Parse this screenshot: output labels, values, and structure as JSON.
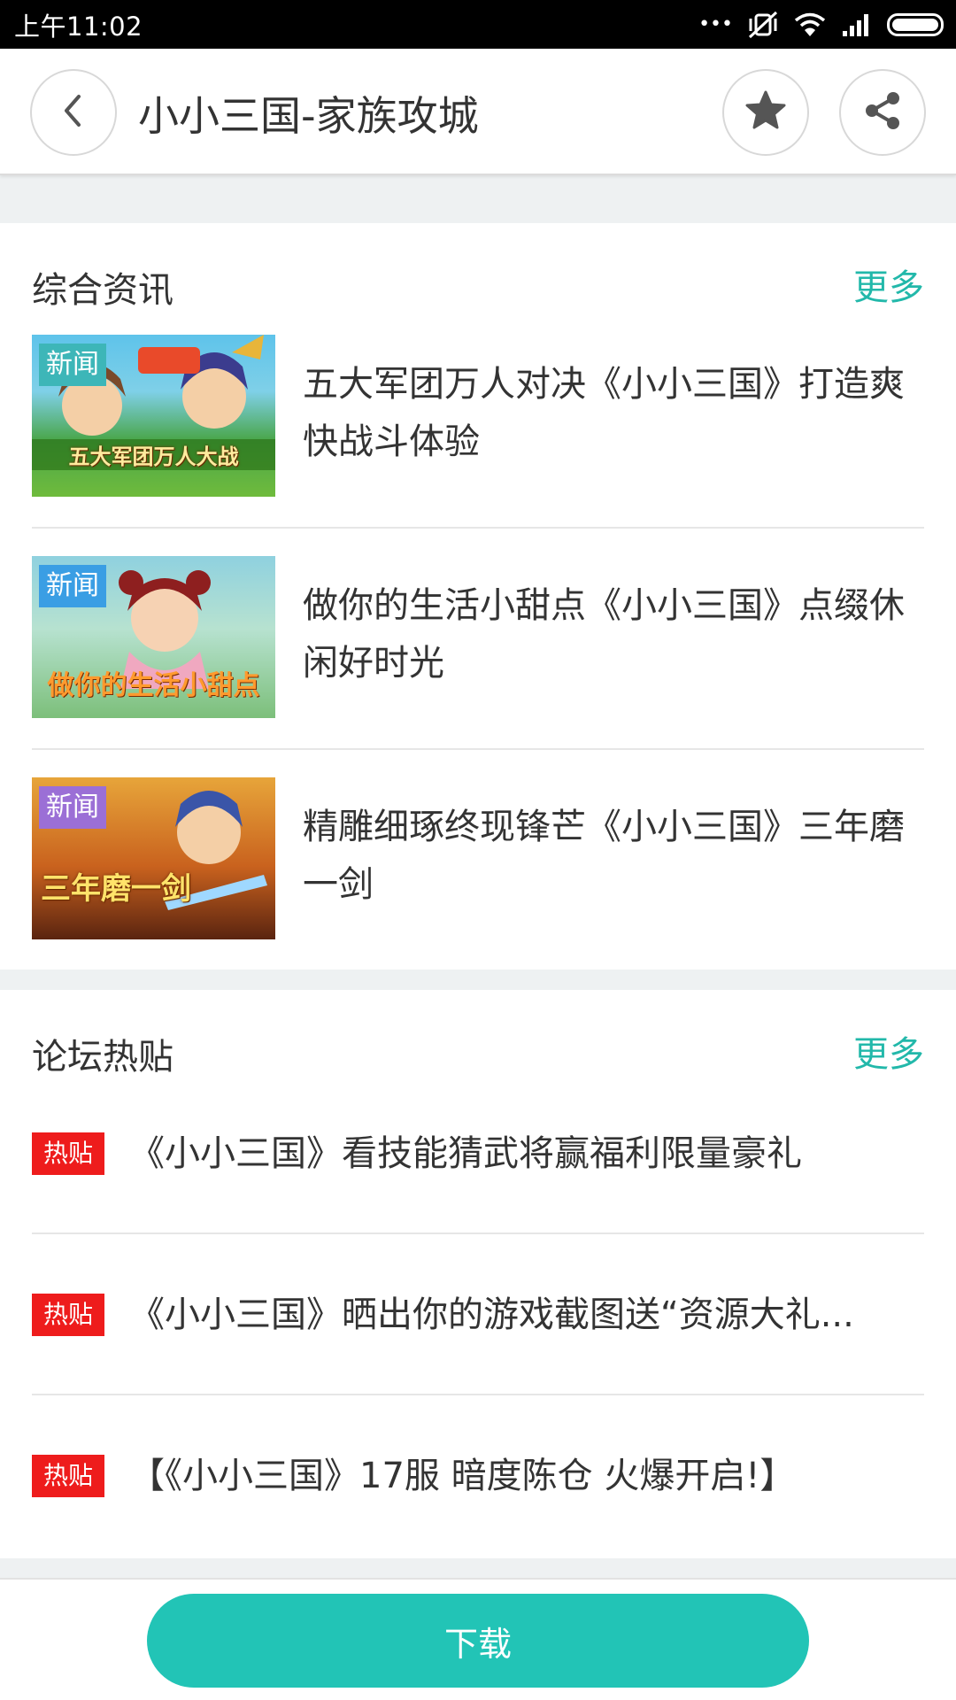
{
  "status_bar": {
    "time": "上午11:02",
    "dots": "•••"
  },
  "header": {
    "title": "小小三国-家族攻城",
    "back_icon": "chevron-left-icon",
    "favorite_icon": "star-icon",
    "share_icon": "share-icon"
  },
  "news": {
    "title": "综合资讯",
    "more": "更多",
    "items": [
      {
        "label": "新闻",
        "label_color": "#3db6b8",
        "caption": "五大军团万人大战",
        "text": "五大军团万人对决《小小三国》打造爽快战斗体验"
      },
      {
        "label": "新闻",
        "label_color": "#3a9ee4",
        "caption": "做你的生活小甜点",
        "text": "做你的生活小甜点《小小三国》点缀休闲好时光"
      },
      {
        "label": "新闻",
        "label_color": "#9b6fd6",
        "caption": "三年磨一剑",
        "text": "精雕细琢终现锋芒《小小三国》三年磨一剑"
      }
    ]
  },
  "forum": {
    "title": "论坛热贴",
    "more": "更多",
    "items": [
      {
        "badge": "热贴",
        "text": "《小小三国》看技能猜武将赢福利限量豪礼"
      },
      {
        "badge": "热贴",
        "text": "《小小三国》晒出你的游戏截图送“资源大礼..."
      },
      {
        "badge": "热贴",
        "text": "【《小小三国》17服 暗度陈仓 火爆开启!】"
      }
    ]
  },
  "bottom": {
    "download": "下载"
  },
  "colors": {
    "accent": "#22c4b6",
    "more_link": "#22b8aa",
    "hot_badge": "#ee1c1c"
  }
}
